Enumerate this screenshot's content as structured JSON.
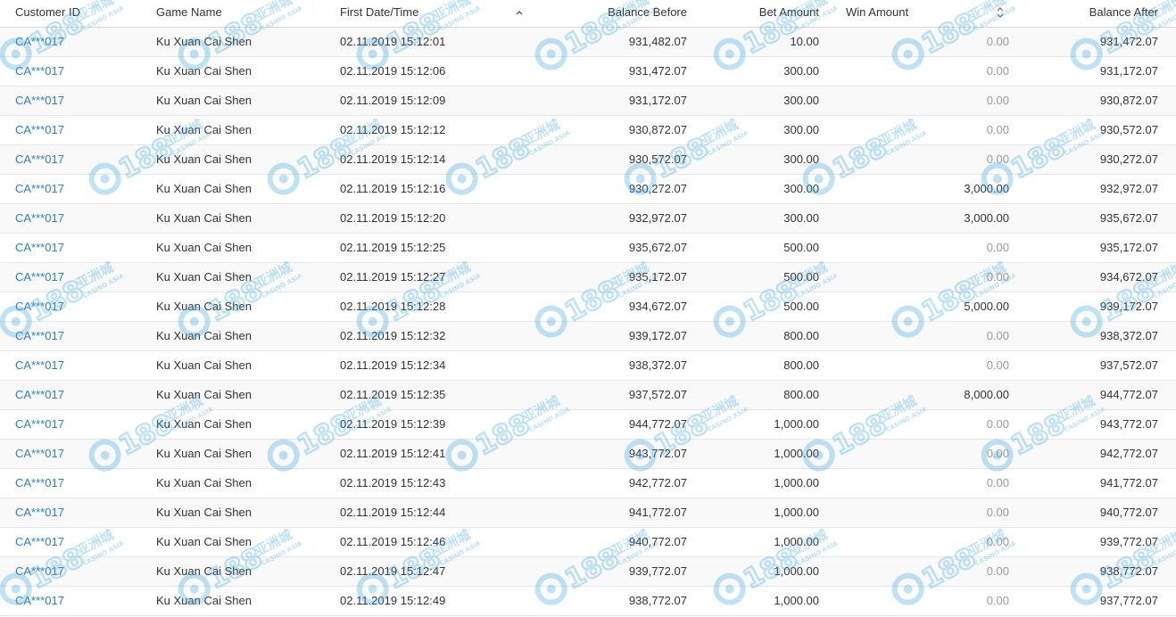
{
  "columns": {
    "customer_id": "Customer ID",
    "game_name": "Game Name",
    "first_date_time": "First Date/Time",
    "balance_before": "Balance Before",
    "bet_amount": "Bet Amount",
    "win_amount": "Win Amount",
    "balance_after": "Balance After"
  },
  "watermark": {
    "text": "C188",
    "sub": "亚洲城",
    "sub2": "CASINO ASIA",
    "color": "#3fa9e0"
  },
  "rows": [
    {
      "id": "CA***017",
      "game": "Ku Xuan Cai Shen",
      "date": "02.11.2019 15:12:01",
      "before": "931,482.07",
      "bet": "10.00",
      "win": "0.00",
      "after": "931,472.07"
    },
    {
      "id": "CA***017",
      "game": "Ku Xuan Cai Shen",
      "date": "02.11.2019 15:12:06",
      "before": "931,472.07",
      "bet": "300.00",
      "win": "0.00",
      "after": "931,172.07"
    },
    {
      "id": "CA***017",
      "game": "Ku Xuan Cai Shen",
      "date": "02.11.2019 15:12:09",
      "before": "931,172.07",
      "bet": "300.00",
      "win": "0.00",
      "after": "930,872.07"
    },
    {
      "id": "CA***017",
      "game": "Ku Xuan Cai Shen",
      "date": "02.11.2019 15:12:12",
      "before": "930,872.07",
      "bet": "300.00",
      "win": "0.00",
      "after": "930,572.07"
    },
    {
      "id": "CA***017",
      "game": "Ku Xuan Cai Shen",
      "date": "02.11.2019 15:12:14",
      "before": "930,572.07",
      "bet": "300.00",
      "win": "0.00",
      "after": "930,272.07"
    },
    {
      "id": "CA***017",
      "game": "Ku Xuan Cai Shen",
      "date": "02.11.2019 15:12:16",
      "before": "930,272.07",
      "bet": "300.00",
      "win": "3,000.00",
      "after": "932,972.07"
    },
    {
      "id": "CA***017",
      "game": "Ku Xuan Cai Shen",
      "date": "02.11.2019 15:12:20",
      "before": "932,972.07",
      "bet": "300.00",
      "win": "3,000.00",
      "after": "935,672.07"
    },
    {
      "id": "CA***017",
      "game": "Ku Xuan Cai Shen",
      "date": "02.11.2019 15:12:25",
      "before": "935,672.07",
      "bet": "500.00",
      "win": "0.00",
      "after": "935,172.07"
    },
    {
      "id": "CA***017",
      "game": "Ku Xuan Cai Shen",
      "date": "02.11.2019 15:12:27",
      "before": "935,172.07",
      "bet": "500.00",
      "win": "0.00",
      "after": "934,672.07"
    },
    {
      "id": "CA***017",
      "game": "Ku Xuan Cai Shen",
      "date": "02.11.2019 15:12:28",
      "before": "934,672.07",
      "bet": "500.00",
      "win": "5,000.00",
      "after": "939,172.07"
    },
    {
      "id": "CA***017",
      "game": "Ku Xuan Cai Shen",
      "date": "02.11.2019 15:12:32",
      "before": "939,172.07",
      "bet": "800.00",
      "win": "0.00",
      "after": "938,372.07"
    },
    {
      "id": "CA***017",
      "game": "Ku Xuan Cai Shen",
      "date": "02.11.2019 15:12:34",
      "before": "938,372.07",
      "bet": "800.00",
      "win": "0.00",
      "after": "937,572.07"
    },
    {
      "id": "CA***017",
      "game": "Ku Xuan Cai Shen",
      "date": "02.11.2019 15:12:35",
      "before": "937,572.07",
      "bet": "800.00",
      "win": "8,000.00",
      "after": "944,772.07"
    },
    {
      "id": "CA***017",
      "game": "Ku Xuan Cai Shen",
      "date": "02.11.2019 15:12:39",
      "before": "944,772.07",
      "bet": "1,000.00",
      "win": "0.00",
      "after": "943,772.07"
    },
    {
      "id": "CA***017",
      "game": "Ku Xuan Cai Shen",
      "date": "02.11.2019 15:12:41",
      "before": "943,772.07",
      "bet": "1,000.00",
      "win": "0.00",
      "after": "942,772.07"
    },
    {
      "id": "CA***017",
      "game": "Ku Xuan Cai Shen",
      "date": "02.11.2019 15:12:43",
      "before": "942,772.07",
      "bet": "1,000.00",
      "win": "0.00",
      "after": "941,772.07"
    },
    {
      "id": "CA***017",
      "game": "Ku Xuan Cai Shen",
      "date": "02.11.2019 15:12:44",
      "before": "941,772.07",
      "bet": "1,000.00",
      "win": "0.00",
      "after": "940,772.07"
    },
    {
      "id": "CA***017",
      "game": "Ku Xuan Cai Shen",
      "date": "02.11.2019 15:12:46",
      "before": "940,772.07",
      "bet": "1,000.00",
      "win": "0.00",
      "after": "939,772.07"
    },
    {
      "id": "CA***017",
      "game": "Ku Xuan Cai Shen",
      "date": "02.11.2019 15:12:47",
      "before": "939,772.07",
      "bet": "1,000.00",
      "win": "0.00",
      "after": "938,772.07"
    },
    {
      "id": "CA***017",
      "game": "Ku Xuan Cai Shen",
      "date": "02.11.2019 15:12:49",
      "before": "938,772.07",
      "bet": "1,000.00",
      "win": "0.00",
      "after": "937,772.07"
    }
  ]
}
